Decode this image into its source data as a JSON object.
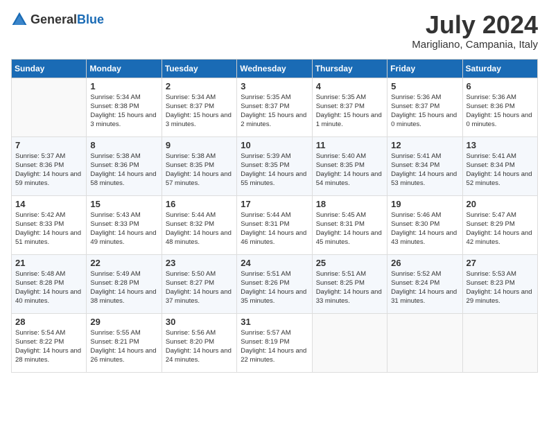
{
  "header": {
    "logo_general": "General",
    "logo_blue": "Blue",
    "month_year": "July 2024",
    "location": "Marigliano, Campania, Italy"
  },
  "columns": [
    "Sunday",
    "Monday",
    "Tuesday",
    "Wednesday",
    "Thursday",
    "Friday",
    "Saturday"
  ],
  "weeks": [
    [
      {
        "day": "",
        "sunrise": "",
        "sunset": "",
        "daylight": "",
        "empty": true
      },
      {
        "day": "1",
        "sunrise": "Sunrise: 5:34 AM",
        "sunset": "Sunset: 8:38 PM",
        "daylight": "Daylight: 15 hours and 3 minutes."
      },
      {
        "day": "2",
        "sunrise": "Sunrise: 5:34 AM",
        "sunset": "Sunset: 8:37 PM",
        "daylight": "Daylight: 15 hours and 3 minutes."
      },
      {
        "day": "3",
        "sunrise": "Sunrise: 5:35 AM",
        "sunset": "Sunset: 8:37 PM",
        "daylight": "Daylight: 15 hours and 2 minutes."
      },
      {
        "day": "4",
        "sunrise": "Sunrise: 5:35 AM",
        "sunset": "Sunset: 8:37 PM",
        "daylight": "Daylight: 15 hours and 1 minute."
      },
      {
        "day": "5",
        "sunrise": "Sunrise: 5:36 AM",
        "sunset": "Sunset: 8:37 PM",
        "daylight": "Daylight: 15 hours and 0 minutes."
      },
      {
        "day": "6",
        "sunrise": "Sunrise: 5:36 AM",
        "sunset": "Sunset: 8:36 PM",
        "daylight": "Daylight: 15 hours and 0 minutes."
      }
    ],
    [
      {
        "day": "7",
        "sunrise": "Sunrise: 5:37 AM",
        "sunset": "Sunset: 8:36 PM",
        "daylight": "Daylight: 14 hours and 59 minutes."
      },
      {
        "day": "8",
        "sunrise": "Sunrise: 5:38 AM",
        "sunset": "Sunset: 8:36 PM",
        "daylight": "Daylight: 14 hours and 58 minutes."
      },
      {
        "day": "9",
        "sunrise": "Sunrise: 5:38 AM",
        "sunset": "Sunset: 8:35 PM",
        "daylight": "Daylight: 14 hours and 57 minutes."
      },
      {
        "day": "10",
        "sunrise": "Sunrise: 5:39 AM",
        "sunset": "Sunset: 8:35 PM",
        "daylight": "Daylight: 14 hours and 55 minutes."
      },
      {
        "day": "11",
        "sunrise": "Sunrise: 5:40 AM",
        "sunset": "Sunset: 8:35 PM",
        "daylight": "Daylight: 14 hours and 54 minutes."
      },
      {
        "day": "12",
        "sunrise": "Sunrise: 5:41 AM",
        "sunset": "Sunset: 8:34 PM",
        "daylight": "Daylight: 14 hours and 53 minutes."
      },
      {
        "day": "13",
        "sunrise": "Sunrise: 5:41 AM",
        "sunset": "Sunset: 8:34 PM",
        "daylight": "Daylight: 14 hours and 52 minutes."
      }
    ],
    [
      {
        "day": "14",
        "sunrise": "Sunrise: 5:42 AM",
        "sunset": "Sunset: 8:33 PM",
        "daylight": "Daylight: 14 hours and 51 minutes."
      },
      {
        "day": "15",
        "sunrise": "Sunrise: 5:43 AM",
        "sunset": "Sunset: 8:33 PM",
        "daylight": "Daylight: 14 hours and 49 minutes."
      },
      {
        "day": "16",
        "sunrise": "Sunrise: 5:44 AM",
        "sunset": "Sunset: 8:32 PM",
        "daylight": "Daylight: 14 hours and 48 minutes."
      },
      {
        "day": "17",
        "sunrise": "Sunrise: 5:44 AM",
        "sunset": "Sunset: 8:31 PM",
        "daylight": "Daylight: 14 hours and 46 minutes."
      },
      {
        "day": "18",
        "sunrise": "Sunrise: 5:45 AM",
        "sunset": "Sunset: 8:31 PM",
        "daylight": "Daylight: 14 hours and 45 minutes."
      },
      {
        "day": "19",
        "sunrise": "Sunrise: 5:46 AM",
        "sunset": "Sunset: 8:30 PM",
        "daylight": "Daylight: 14 hours and 43 minutes."
      },
      {
        "day": "20",
        "sunrise": "Sunrise: 5:47 AM",
        "sunset": "Sunset: 8:29 PM",
        "daylight": "Daylight: 14 hours and 42 minutes."
      }
    ],
    [
      {
        "day": "21",
        "sunrise": "Sunrise: 5:48 AM",
        "sunset": "Sunset: 8:28 PM",
        "daylight": "Daylight: 14 hours and 40 minutes."
      },
      {
        "day": "22",
        "sunrise": "Sunrise: 5:49 AM",
        "sunset": "Sunset: 8:28 PM",
        "daylight": "Daylight: 14 hours and 38 minutes."
      },
      {
        "day": "23",
        "sunrise": "Sunrise: 5:50 AM",
        "sunset": "Sunset: 8:27 PM",
        "daylight": "Daylight: 14 hours and 37 minutes."
      },
      {
        "day": "24",
        "sunrise": "Sunrise: 5:51 AM",
        "sunset": "Sunset: 8:26 PM",
        "daylight": "Daylight: 14 hours and 35 minutes."
      },
      {
        "day": "25",
        "sunrise": "Sunrise: 5:51 AM",
        "sunset": "Sunset: 8:25 PM",
        "daylight": "Daylight: 14 hours and 33 minutes."
      },
      {
        "day": "26",
        "sunrise": "Sunrise: 5:52 AM",
        "sunset": "Sunset: 8:24 PM",
        "daylight": "Daylight: 14 hours and 31 minutes."
      },
      {
        "day": "27",
        "sunrise": "Sunrise: 5:53 AM",
        "sunset": "Sunset: 8:23 PM",
        "daylight": "Daylight: 14 hours and 29 minutes."
      }
    ],
    [
      {
        "day": "28",
        "sunrise": "Sunrise: 5:54 AM",
        "sunset": "Sunset: 8:22 PM",
        "daylight": "Daylight: 14 hours and 28 minutes."
      },
      {
        "day": "29",
        "sunrise": "Sunrise: 5:55 AM",
        "sunset": "Sunset: 8:21 PM",
        "daylight": "Daylight: 14 hours and 26 minutes."
      },
      {
        "day": "30",
        "sunrise": "Sunrise: 5:56 AM",
        "sunset": "Sunset: 8:20 PM",
        "daylight": "Daylight: 14 hours and 24 minutes."
      },
      {
        "day": "31",
        "sunrise": "Sunrise: 5:57 AM",
        "sunset": "Sunset: 8:19 PM",
        "daylight": "Daylight: 14 hours and 22 minutes."
      },
      {
        "day": "",
        "sunrise": "",
        "sunset": "",
        "daylight": "",
        "empty": true
      },
      {
        "day": "",
        "sunrise": "",
        "sunset": "",
        "daylight": "",
        "empty": true
      },
      {
        "day": "",
        "sunrise": "",
        "sunset": "",
        "daylight": "",
        "empty": true
      }
    ]
  ]
}
